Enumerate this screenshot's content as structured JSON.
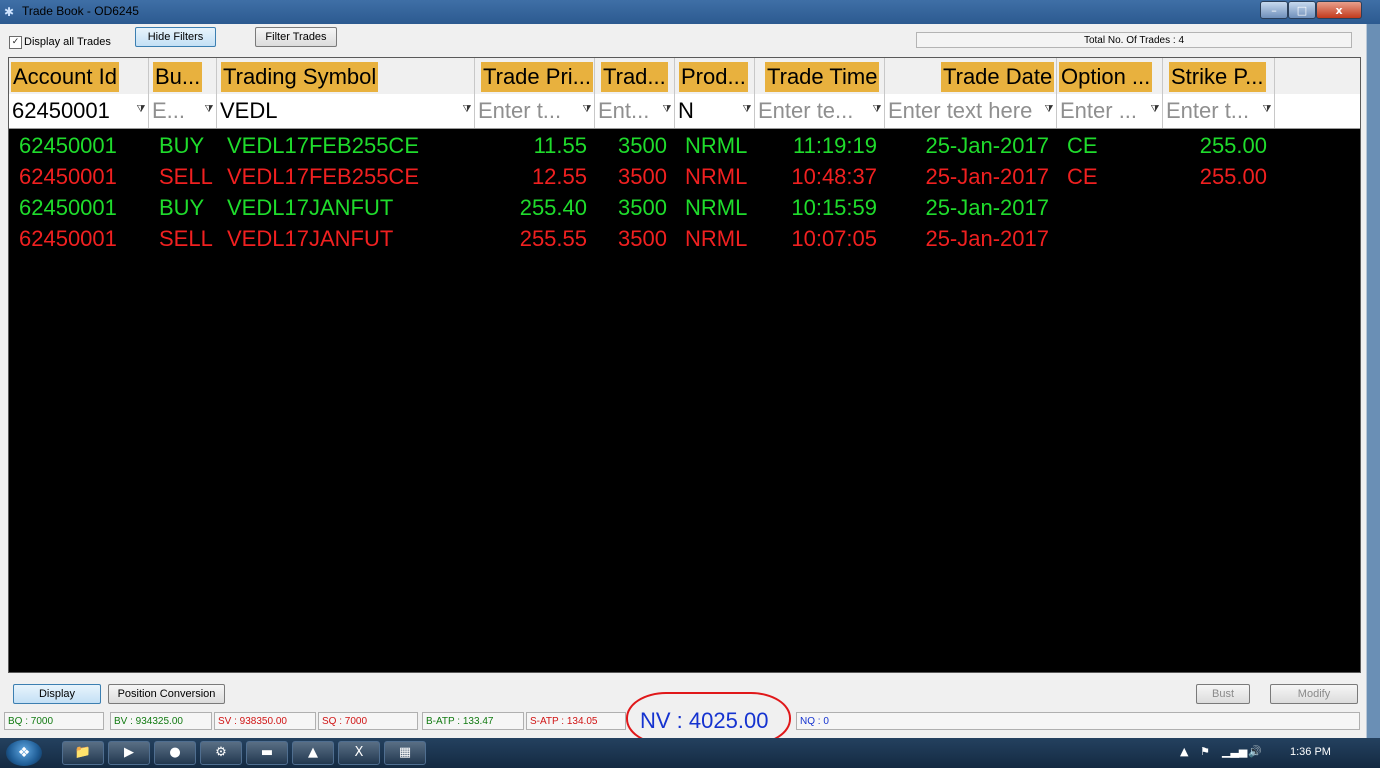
{
  "window": {
    "title": "Trade Book - OD6245",
    "min": "–",
    "max": "□",
    "close": "x"
  },
  "toolbar": {
    "display_all_label": "Display all Trades",
    "display_all_checked": true,
    "hide_filters": "Hide Filters",
    "filter_trades": "Filter Trades",
    "total_trades": "Total No. Of Trades : 4"
  },
  "grid": {
    "columns": [
      {
        "label": "Account Id",
        "filter_value": "62450001",
        "filter_placeholder": ""
      },
      {
        "label": "Bu...",
        "filter_value": "",
        "filter_placeholder": "E..."
      },
      {
        "label": "Trading Symbol",
        "filter_value": "VEDL",
        "filter_placeholder": ""
      },
      {
        "label": "Trade Pri...",
        "filter_value": "",
        "filter_placeholder": "Enter t..."
      },
      {
        "label": "Trad...",
        "filter_value": "",
        "filter_placeholder": "Ent..."
      },
      {
        "label": "Prod...",
        "filter_value": "N",
        "filter_placeholder": ""
      },
      {
        "label": "Trade Time",
        "filter_value": "",
        "filter_placeholder": "Enter te..."
      },
      {
        "label": "Trade Date",
        "filter_value": "",
        "filter_placeholder": "Enter text here"
      },
      {
        "label": "Option ...",
        "filter_value": "",
        "filter_placeholder": "Enter ..."
      },
      {
        "label": "Strike P...",
        "filter_value": "",
        "filter_placeholder": "Enter t..."
      }
    ],
    "rows": [
      {
        "side": "buy",
        "account": "62450001",
        "buysell": "BUY",
        "symbol": "VEDL17FEB255CE",
        "price": "11.55",
        "qty": "3500",
        "product": "NRML",
        "time": "11:19:19",
        "date": "25-Jan-2017",
        "option": "CE",
        "strike": "255.00"
      },
      {
        "side": "sell",
        "account": "62450001",
        "buysell": "SELL",
        "symbol": "VEDL17FEB255CE",
        "price": "12.55",
        "qty": "3500",
        "product": "NRML",
        "time": "10:48:37",
        "date": "25-Jan-2017",
        "option": "CE",
        "strike": "255.00"
      },
      {
        "side": "buy",
        "account": "62450001",
        "buysell": "BUY",
        "symbol": "VEDL17JANFUT",
        "price": "255.40",
        "qty": "3500",
        "product": "NRML",
        "time": "10:15:59",
        "date": "25-Jan-2017",
        "option": "",
        "strike": ""
      },
      {
        "side": "sell",
        "account": "62450001",
        "buysell": "SELL",
        "symbol": "VEDL17JANFUT",
        "price": "255.55",
        "qty": "3500",
        "product": "NRML",
        "time": "10:07:05",
        "date": "25-Jan-2017",
        "option": "",
        "strike": ""
      }
    ]
  },
  "bottom": {
    "display": "Display",
    "position_conversion": "Position Conversion",
    "bust": "Bust",
    "modify": "Modify"
  },
  "status": {
    "bq": "BQ : 7000",
    "bv": "BV : 934325.00",
    "sv": "SV : 938350.00",
    "sq": "SQ : 7000",
    "batp": "B-ATP : 133.47",
    "satp": "S-ATP : 134.05",
    "nv": "NV : 4025.00",
    "nq": "NQ : 0"
  },
  "colors": {
    "buy": "#1fdc2c",
    "sell": "#f02020",
    "header": "#e8b13e",
    "grid_bg": "#000000",
    "highlight": "#e0181a"
  },
  "taskbar": {
    "clock": "1:36 PM",
    "items": [
      "explorer-icon",
      "media-player-icon",
      "chrome-icon",
      "app-icon",
      "folder-icon",
      "drive-icon",
      "excel-icon",
      "calculator-icon"
    ]
  }
}
